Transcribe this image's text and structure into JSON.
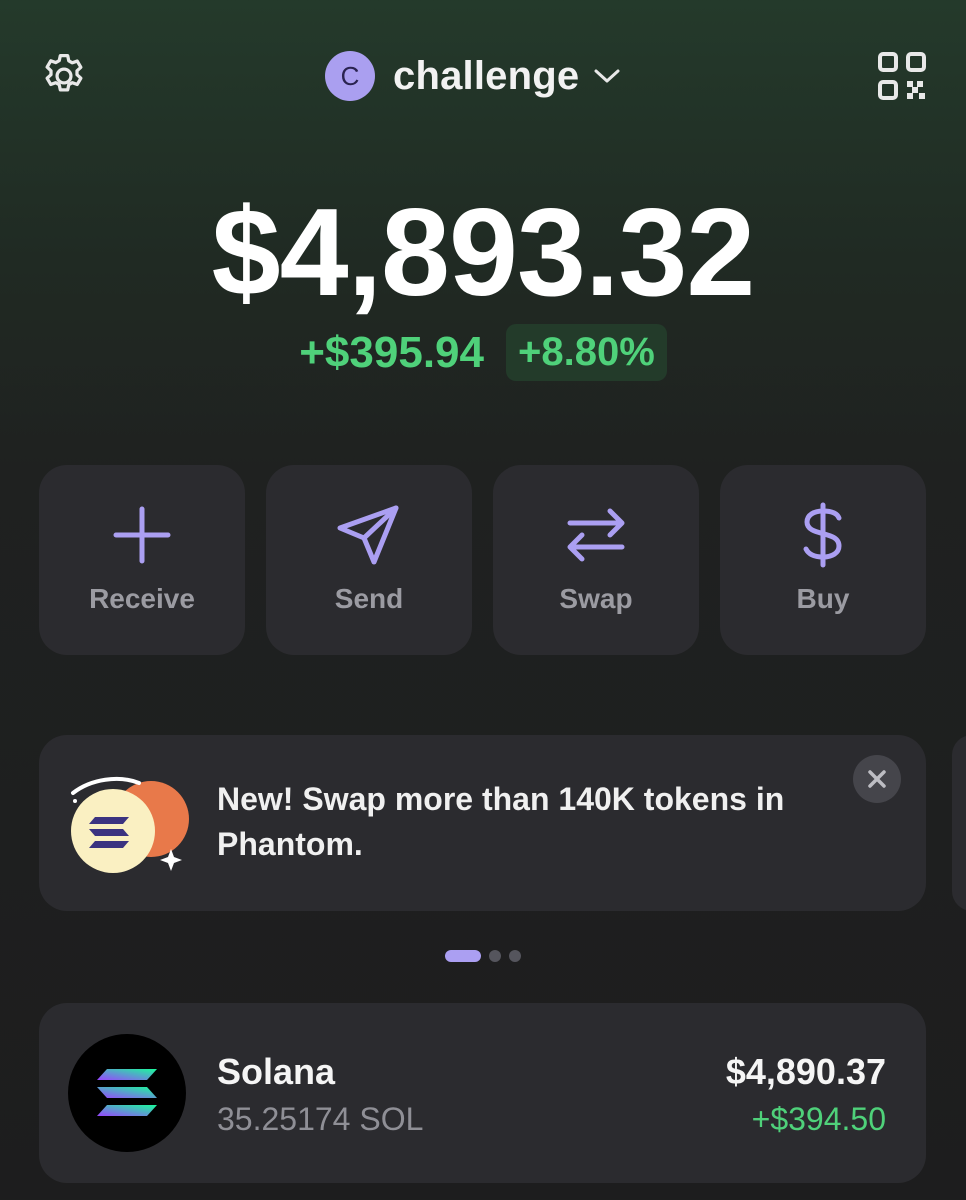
{
  "header": {
    "account_initial": "C",
    "account_name": "challenge",
    "icons": {
      "settings": "gear-icon",
      "qr": "qr-code-icon",
      "dropdown": "chevron-down-icon"
    }
  },
  "balance": {
    "total": "$4,893.32",
    "change_amount": "+$395.94",
    "change_percent": "+8.80%"
  },
  "actions": [
    {
      "label": "Receive",
      "icon": "plus-icon"
    },
    {
      "label": "Send",
      "icon": "send-icon"
    },
    {
      "label": "Swap",
      "icon": "swap-arrows-icon"
    },
    {
      "label": "Buy",
      "icon": "dollar-icon"
    }
  ],
  "promo": {
    "text": "New! Swap more than 140K tokens in Phantom.",
    "pager": {
      "count": 3,
      "active_index": 0
    }
  },
  "tokens": [
    {
      "name": "Solana",
      "amount": "35.25174 SOL",
      "value": "$4,890.37",
      "change": "+$394.50"
    }
  ],
  "colors": {
    "accent": "#ab9ff2",
    "positive": "#4fd17a",
    "card": "#2b2b2f",
    "muted_text": "#9b9ba2"
  }
}
